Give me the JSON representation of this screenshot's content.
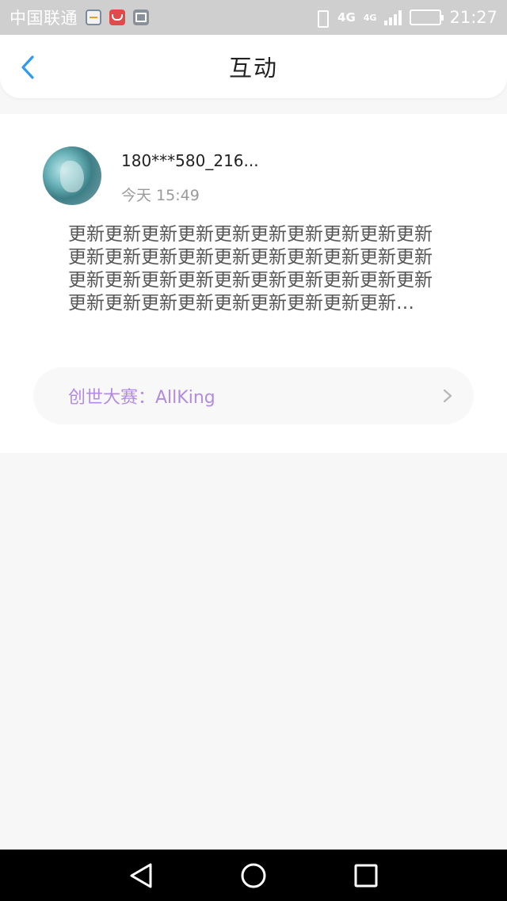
{
  "status_bar": {
    "carrier": "中国联通",
    "network": "4G",
    "network2": "4G",
    "time": "21:27",
    "battery_level": 0.8,
    "icons": [
      "note-icon",
      "red-app-icon",
      "image-icon",
      "vibrate-icon",
      "signal-icon",
      "battery-icon"
    ]
  },
  "header": {
    "title": "互动",
    "back_icon": "chevron-left-icon"
  },
  "post": {
    "username": "180***580_216...",
    "timestamp": "今天 15:49",
    "body": "更新更新更新更新更新更新更新更新更新更新更新更新更新更新更新更新更新更新更新更新更新更新更新更新更新更新更新更新更新更新更新更新更新更新更新更新更新更新更新…",
    "topic": "创世大赛：AllKing",
    "topic_icon": "chevron-right-icon"
  },
  "nav_bar": {
    "icons": [
      "back-triangle-icon",
      "home-circle-icon",
      "recents-square-icon"
    ]
  },
  "colors": {
    "accent_blue": "#2f9af0",
    "topic_purple": "#b38be0",
    "status_bar_bg": "#cfcfcf",
    "page_bg": "#f7f7f7"
  }
}
